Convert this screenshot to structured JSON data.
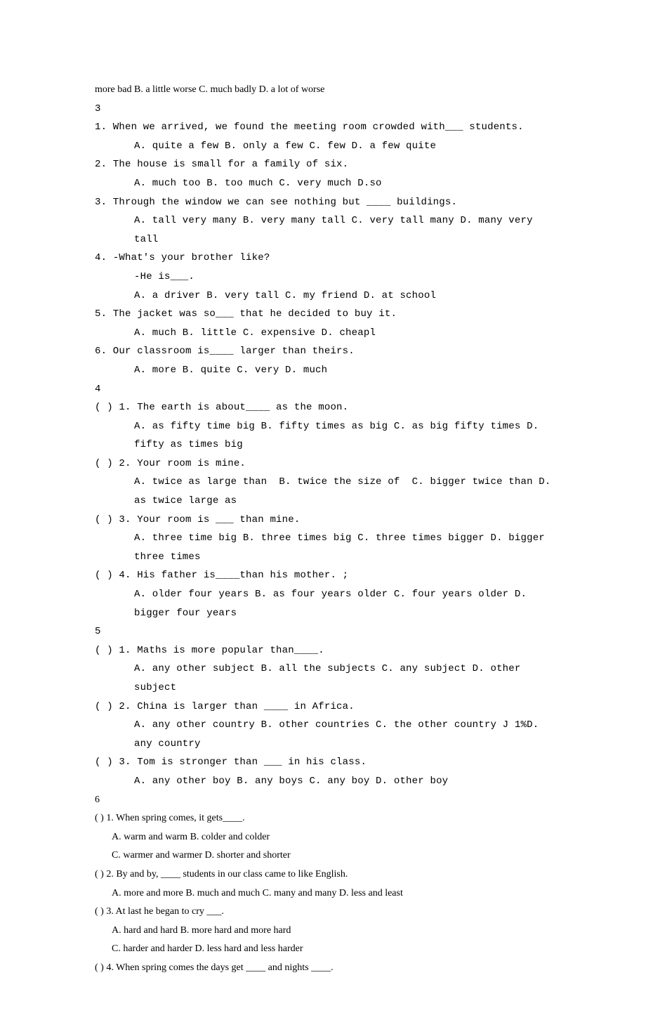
{
  "topline": "more bad B. a little worse C. much badly D. a lot of worse",
  "s3": {
    "heading": "3",
    "q1": "1. When we arrived, we found the meeting room crowded with___ students.",
    "q1opts": "A. quite a few B. only a few C. few D. a few quite",
    "q2": "2. The house is small for a family of six.",
    "q2opts": "A. much too B. too much C. very much D.so",
    "q3": "3. Through the window we can see nothing but ____ buildings.",
    "q3opts": "A. tall very many B. very many tall C. very tall many D. many very tall",
    "q4a": "4. -What's your brother like?",
    "q4b": "-He is___.",
    "q4opts": "A. a driver B. very tall C. my friend D. at school",
    "q5": "5. The jacket was so___ that he decided to buy it.",
    "q5opts": "A. much B. little C. expensive D. cheapl",
    "q6": "6. Our classroom is____ larger than theirs.",
    "q6opts": "A. more B. quite C. very D. much"
  },
  "s4": {
    "heading": "4",
    "q1": "( ) 1. The earth is about____ as the moon.",
    "q1opts": "A. as fifty time big B. fifty times as big C. as big fifty times D. fifty as times big",
    "q2": "( ) 2. Your room is mine.",
    "q2opts": "A. twice as large than  B. twice the size of  C. bigger twice than D. as twice large as",
    "q3": "( ) 3. Your room is ___ than mine.",
    "q3opts": "A. three time big B. three times big C. three times bigger D. bigger three times",
    "q4": "( ) 4. His father is____than his mother. ;",
    "q4opts": "A. older four years B. as four years older C. four years older D. bigger four years"
  },
  "s5": {
    "heading": "5",
    "q1": "( ) 1. Maths is more popular than____.",
    "q1opts": "A. any other subject B. all the subjects C. any subject D. other subject",
    "q2": "( ) 2. China is larger than ____ in Africa.",
    "q2opts": "A. any other country B. other countries C. the other country J 1%D. any country",
    "q3": "( ) 3. Tom is stronger than ___ in his class.",
    "q3opts": "A. any other boy B. any boys C. any boy D. other boy"
  },
  "s6": {
    "heading": "6",
    "q1": "( ) 1. When spring comes, it gets____.",
    "q1a": "A. warm and warm B. colder and colder",
    "q1b": "C. warmer and warmer D. shorter and shorter",
    "q2": "( ) 2. By and by, ____ students in our class came to like English.",
    "q2opts": "A. more and more B. much and much C. many and many D. less and least",
    "q3": "( ) 3. At last he began to cry ___.",
    "q3a": "A. hard and hard B. more hard and more hard",
    "q3b": "C. harder and harder D. less hard and less harder",
    "q4": "( ) 4. When spring comes the days get ____ and nights ____."
  }
}
